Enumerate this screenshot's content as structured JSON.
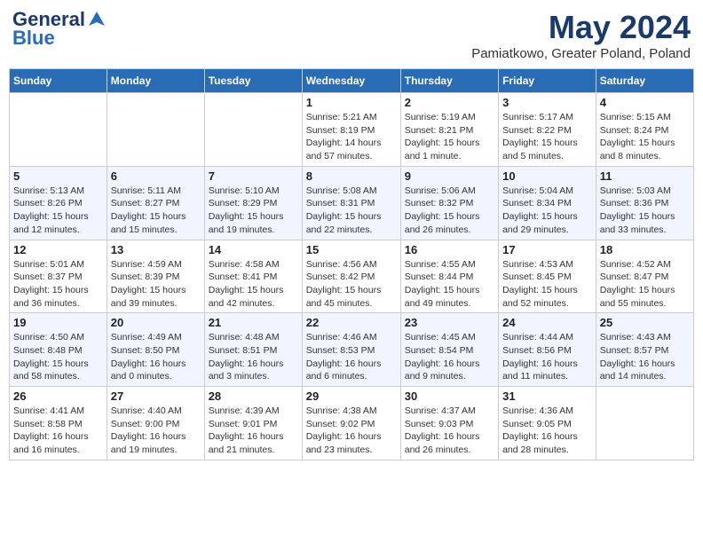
{
  "header": {
    "logo_line1": "General",
    "logo_line2": "Blue",
    "month_title": "May 2024",
    "subtitle": "Pamiatkowo, Greater Poland, Poland"
  },
  "days_of_week": [
    "Sunday",
    "Monday",
    "Tuesday",
    "Wednesday",
    "Thursday",
    "Friday",
    "Saturday"
  ],
  "weeks": [
    [
      {
        "day": "",
        "info": ""
      },
      {
        "day": "",
        "info": ""
      },
      {
        "day": "",
        "info": ""
      },
      {
        "day": "1",
        "info": "Sunrise: 5:21 AM\nSunset: 8:19 PM\nDaylight: 14 hours\nand 57 minutes."
      },
      {
        "day": "2",
        "info": "Sunrise: 5:19 AM\nSunset: 8:21 PM\nDaylight: 15 hours\nand 1 minute."
      },
      {
        "day": "3",
        "info": "Sunrise: 5:17 AM\nSunset: 8:22 PM\nDaylight: 15 hours\nand 5 minutes."
      },
      {
        "day": "4",
        "info": "Sunrise: 5:15 AM\nSunset: 8:24 PM\nDaylight: 15 hours\nand 8 minutes."
      }
    ],
    [
      {
        "day": "5",
        "info": "Sunrise: 5:13 AM\nSunset: 8:26 PM\nDaylight: 15 hours\nand 12 minutes."
      },
      {
        "day": "6",
        "info": "Sunrise: 5:11 AM\nSunset: 8:27 PM\nDaylight: 15 hours\nand 15 minutes."
      },
      {
        "day": "7",
        "info": "Sunrise: 5:10 AM\nSunset: 8:29 PM\nDaylight: 15 hours\nand 19 minutes."
      },
      {
        "day": "8",
        "info": "Sunrise: 5:08 AM\nSunset: 8:31 PM\nDaylight: 15 hours\nand 22 minutes."
      },
      {
        "day": "9",
        "info": "Sunrise: 5:06 AM\nSunset: 8:32 PM\nDaylight: 15 hours\nand 26 minutes."
      },
      {
        "day": "10",
        "info": "Sunrise: 5:04 AM\nSunset: 8:34 PM\nDaylight: 15 hours\nand 29 minutes."
      },
      {
        "day": "11",
        "info": "Sunrise: 5:03 AM\nSunset: 8:36 PM\nDaylight: 15 hours\nand 33 minutes."
      }
    ],
    [
      {
        "day": "12",
        "info": "Sunrise: 5:01 AM\nSunset: 8:37 PM\nDaylight: 15 hours\nand 36 minutes."
      },
      {
        "day": "13",
        "info": "Sunrise: 4:59 AM\nSunset: 8:39 PM\nDaylight: 15 hours\nand 39 minutes."
      },
      {
        "day": "14",
        "info": "Sunrise: 4:58 AM\nSunset: 8:41 PM\nDaylight: 15 hours\nand 42 minutes."
      },
      {
        "day": "15",
        "info": "Sunrise: 4:56 AM\nSunset: 8:42 PM\nDaylight: 15 hours\nand 45 minutes."
      },
      {
        "day": "16",
        "info": "Sunrise: 4:55 AM\nSunset: 8:44 PM\nDaylight: 15 hours\nand 49 minutes."
      },
      {
        "day": "17",
        "info": "Sunrise: 4:53 AM\nSunset: 8:45 PM\nDaylight: 15 hours\nand 52 minutes."
      },
      {
        "day": "18",
        "info": "Sunrise: 4:52 AM\nSunset: 8:47 PM\nDaylight: 15 hours\nand 55 minutes."
      }
    ],
    [
      {
        "day": "19",
        "info": "Sunrise: 4:50 AM\nSunset: 8:48 PM\nDaylight: 15 hours\nand 58 minutes."
      },
      {
        "day": "20",
        "info": "Sunrise: 4:49 AM\nSunset: 8:50 PM\nDaylight: 16 hours\nand 0 minutes."
      },
      {
        "day": "21",
        "info": "Sunrise: 4:48 AM\nSunset: 8:51 PM\nDaylight: 16 hours\nand 3 minutes."
      },
      {
        "day": "22",
        "info": "Sunrise: 4:46 AM\nSunset: 8:53 PM\nDaylight: 16 hours\nand 6 minutes."
      },
      {
        "day": "23",
        "info": "Sunrise: 4:45 AM\nSunset: 8:54 PM\nDaylight: 16 hours\nand 9 minutes."
      },
      {
        "day": "24",
        "info": "Sunrise: 4:44 AM\nSunset: 8:56 PM\nDaylight: 16 hours\nand 11 minutes."
      },
      {
        "day": "25",
        "info": "Sunrise: 4:43 AM\nSunset: 8:57 PM\nDaylight: 16 hours\nand 14 minutes."
      }
    ],
    [
      {
        "day": "26",
        "info": "Sunrise: 4:41 AM\nSunset: 8:58 PM\nDaylight: 16 hours\nand 16 minutes."
      },
      {
        "day": "27",
        "info": "Sunrise: 4:40 AM\nSunset: 9:00 PM\nDaylight: 16 hours\nand 19 minutes."
      },
      {
        "day": "28",
        "info": "Sunrise: 4:39 AM\nSunset: 9:01 PM\nDaylight: 16 hours\nand 21 minutes."
      },
      {
        "day": "29",
        "info": "Sunrise: 4:38 AM\nSunset: 9:02 PM\nDaylight: 16 hours\nand 23 minutes."
      },
      {
        "day": "30",
        "info": "Sunrise: 4:37 AM\nSunset: 9:03 PM\nDaylight: 16 hours\nand 26 minutes."
      },
      {
        "day": "31",
        "info": "Sunrise: 4:36 AM\nSunset: 9:05 PM\nDaylight: 16 hours\nand 28 minutes."
      },
      {
        "day": "",
        "info": ""
      }
    ]
  ]
}
